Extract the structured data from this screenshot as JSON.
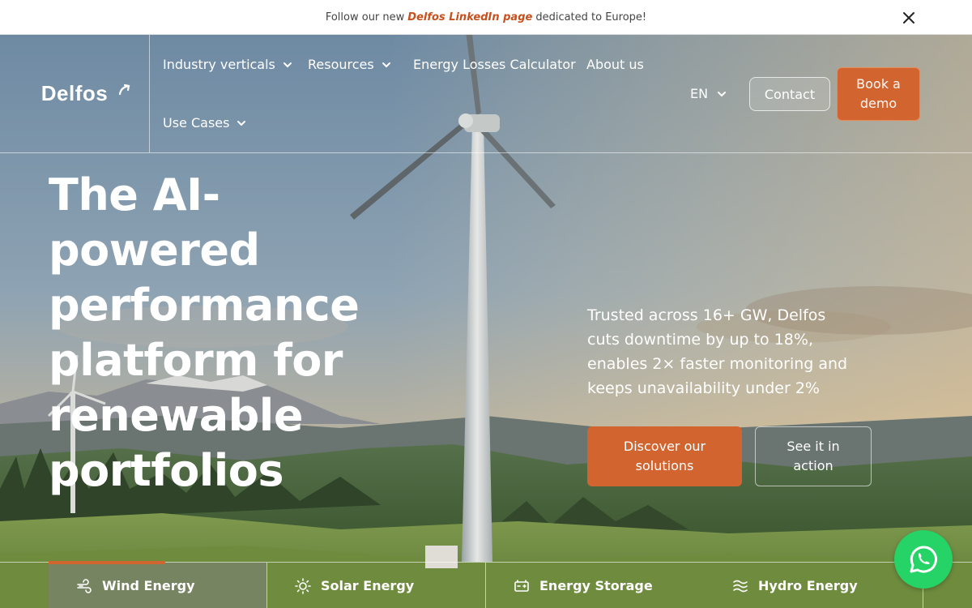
{
  "announcement": {
    "prefix": "Follow our new",
    "link": "Delfos LinkedIn page",
    "suffix": "dedicated to Europe!"
  },
  "logo": {
    "text": "Delfos"
  },
  "nav": {
    "items": [
      {
        "label": "Industry verticals",
        "has_dropdown": true
      },
      {
        "label": "Resources",
        "has_dropdown": true
      },
      {
        "label": "Energy Losses Calculator",
        "has_dropdown": false
      },
      {
        "label": "About us",
        "has_dropdown": false
      },
      {
        "label": "Use Cases",
        "has_dropdown": true
      }
    ],
    "language": "EN",
    "contact_label": "Contact",
    "demo_label": "Book a demo"
  },
  "hero": {
    "headline": "The AI-powered performance platform for renewable portfolios",
    "subtext": "Trusted across 16+ GW, Delfos cuts downtime by up to 18%, enables 2× faster monitoring and keeps unavailability under 2%",
    "cta_primary": "Discover our solutions",
    "cta_secondary": "See it in action"
  },
  "tabs": [
    {
      "label": "Wind Energy",
      "icon": "wind-icon",
      "active": true
    },
    {
      "label": "Solar Energy",
      "icon": "sun-icon",
      "active": false
    },
    {
      "label": "Energy Storage",
      "icon": "battery-icon",
      "active": false
    },
    {
      "label": "Hydro Energy",
      "icon": "waves-icon",
      "active": false
    }
  ],
  "colors": {
    "accent": "#d2642f",
    "whatsapp": "#25d366"
  }
}
